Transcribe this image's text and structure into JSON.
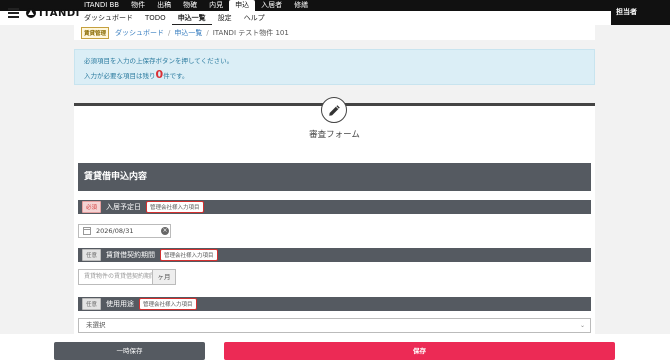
{
  "app": {
    "logo": "ITANDI",
    "user": "担当者"
  },
  "topnav": [
    "ITANDI BB",
    "物件",
    "出稿",
    "物確",
    "内見",
    "申込",
    "入居者",
    "修繕"
  ],
  "topnav_active": "申込",
  "subnav": [
    "ダッシュボード",
    "TODO",
    "申込一覧",
    "設定",
    "ヘルプ"
  ],
  "subnav_active": "申込一覧",
  "breadcrumb": {
    "tag": "賃貸管理",
    "items": [
      "ダッシュボード",
      "申込一覧"
    ],
    "current": "ITANDI テスト物件 101"
  },
  "info": {
    "line1": "必須項目を入力の上保存ボタンを押してください。",
    "line2_prefix": "入力が必要な項目は残り",
    "remaining": "0",
    "line2_suffix": "件です。"
  },
  "form": {
    "title": "審査フォーム",
    "section": "賃貸借申込内容",
    "fields": [
      {
        "badge": "必須",
        "label": "入居予定日",
        "tag": "管理会社様入力項目",
        "value": "2026/08/31"
      },
      {
        "badge": "任意",
        "label": "賃貸借契約期間",
        "tag": "管理会社様入力項目",
        "placeholder": "賃貸物件の賃貸借契約期間",
        "unit": "ヶ月"
      },
      {
        "badge": "任意",
        "label": "使用用途",
        "tag": "管理会社様入力項目",
        "selected": "未選択"
      }
    ]
  },
  "buttons": {
    "temp_save": "一時保存",
    "save": "保存"
  }
}
